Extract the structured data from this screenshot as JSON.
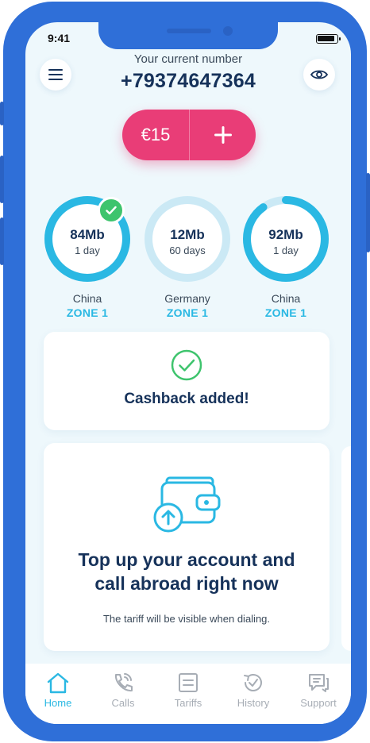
{
  "status_bar": {
    "time": "9:41"
  },
  "header": {
    "number_label": "Your current number",
    "phone_number": "+79374647364"
  },
  "balance": {
    "amount": "€15"
  },
  "packages": [
    {
      "amount": "84Mb",
      "duration": "1 day",
      "country": "China",
      "zone": "ZONE 1",
      "remaining_fraction": 1.0,
      "active": true
    },
    {
      "amount": "12Mb",
      "duration": "60 days",
      "country": "Germany",
      "zone": "ZONE 1",
      "remaining_fraction": 0.0,
      "active": false
    },
    {
      "amount": "92Mb",
      "duration": "1 day",
      "country": "China",
      "zone": "ZONE 1",
      "remaining_fraction": 0.9,
      "active": false
    }
  ],
  "cashback": {
    "message": "Cashback added!"
  },
  "topup": {
    "title_line1": "Top up your account and",
    "title_line2": "call abroad right now",
    "subtitle": "The tariff will be visible when dialing."
  },
  "tabs": [
    {
      "label": "Home",
      "icon": "home-icon",
      "active": true
    },
    {
      "label": "Calls",
      "icon": "phone-icon",
      "active": false
    },
    {
      "label": "Tariffs",
      "icon": "tariffs-icon",
      "active": false
    },
    {
      "label": "History",
      "icon": "history-icon",
      "active": false
    },
    {
      "label": "Support",
      "icon": "support-icon",
      "active": false
    }
  ],
  "colors": {
    "frame": "#2f6fd8",
    "accent_pink": "#e93d77",
    "accent_cyan": "#2ab8e3",
    "ring_track": "#cbe9f5",
    "success_green": "#3ec46d",
    "text_dark": "#16325a",
    "tab_inactive": "#a7adb5"
  }
}
